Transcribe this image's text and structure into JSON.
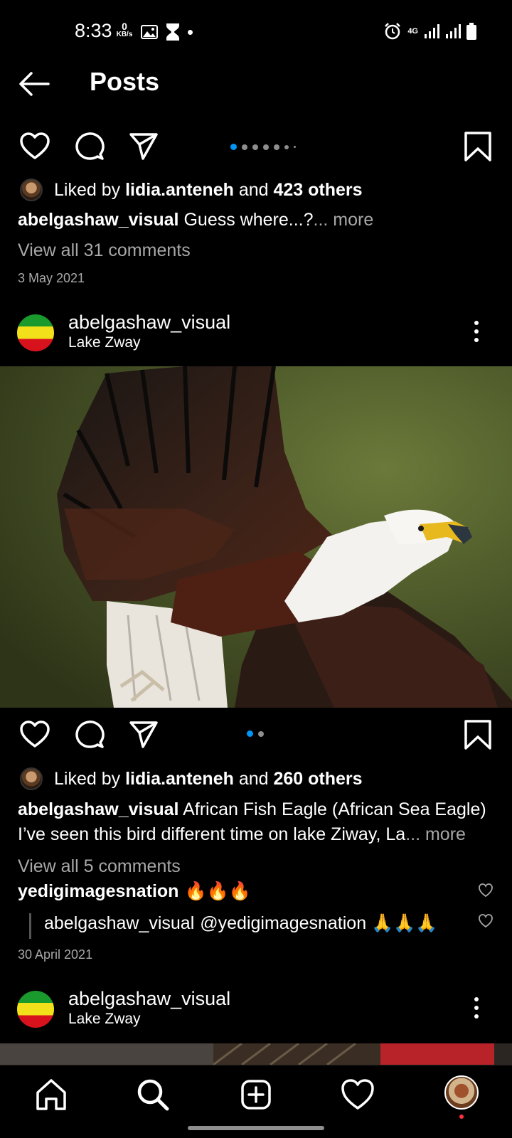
{
  "status_bar": {
    "time": "8:33",
    "data_speed_value": "0",
    "data_speed_unit": "KB/s",
    "network": "4G"
  },
  "header": {
    "title": "Posts",
    "back_icon": "arrow-left-icon"
  },
  "post1": {
    "liked_prefix": "Liked by ",
    "liked_user": "lidia.anteneh",
    "liked_and": " and ",
    "liked_others": "423 others",
    "caption_user": "abelgashaw_visual",
    "caption_text": "Guess where...?",
    "caption_more": "... more",
    "view_comments": "View all 31 comments",
    "date": "3 May 2021"
  },
  "post2": {
    "user": "abelgashaw_visual",
    "location": "Lake Zway",
    "liked_prefix": "Liked by ",
    "liked_user": "lidia.anteneh",
    "liked_and": " and ",
    "liked_others": "260 others",
    "caption_user": "abelgashaw_visual",
    "caption_line1": "African Fish Eagle (African Sea Eagle)",
    "caption_line2": "I’ve seen this bird different time on lake Ziway, La",
    "caption_more": "... more",
    "view_comments": "View all 5 comments",
    "comment1_user": "yedigimagesnation",
    "comment1_text": "🔥🔥🔥",
    "reply_user": "abelgashaw_visual",
    "reply_text": "@yedigimagesnation 🙏🙏🙏",
    "date": "30 April 2021"
  },
  "post3": {
    "user": "abelgashaw_visual",
    "location": "Lake Zway"
  },
  "bottom_nav": {
    "items": [
      "home-icon",
      "search-icon",
      "new-post-icon",
      "activity-heart-icon",
      "profile-avatar"
    ]
  },
  "colors": {
    "background": "#000000",
    "accent": "#0095f6",
    "muted": "#a8a8a8"
  }
}
